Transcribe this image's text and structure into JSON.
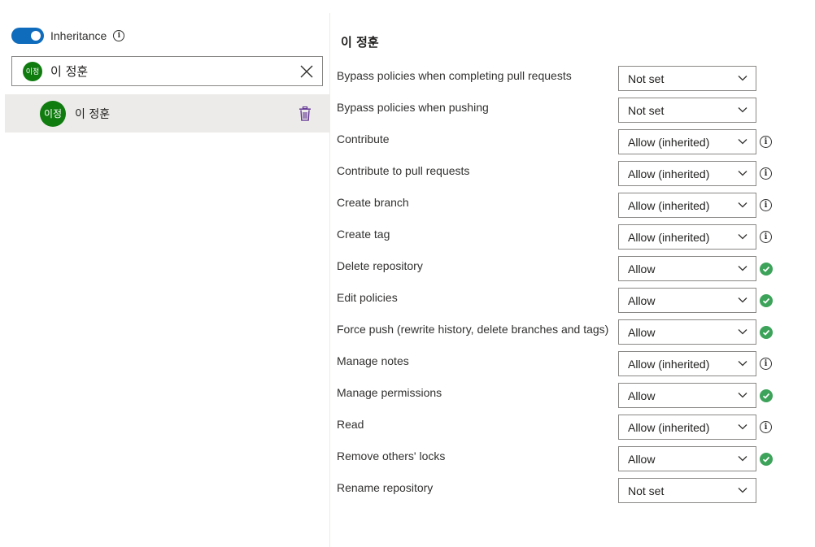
{
  "inheritance": {
    "label": "Inheritance",
    "enabled": true
  },
  "search": {
    "avatar_initials": "이정",
    "value": "이 정훈"
  },
  "selected_user": {
    "avatar_initials": "이정",
    "name": "이 정훈"
  },
  "detail": {
    "title": "이 정훈"
  },
  "colors": {
    "accent": "#0f6cbd",
    "avatar": "#107c10",
    "allow_check": "#3da35a",
    "selected_row": "#edebe9"
  },
  "permissions": [
    {
      "label": "Bypass policies when completing pull requests",
      "value": "Not set",
      "status": "none"
    },
    {
      "label": "Bypass policies when pushing",
      "value": "Not set",
      "status": "none"
    },
    {
      "label": "Contribute",
      "value": "Allow (inherited)",
      "status": "info-icon"
    },
    {
      "label": "Contribute to pull requests",
      "value": "Allow (inherited)",
      "status": "info-icon"
    },
    {
      "label": "Create branch",
      "value": "Allow (inherited)",
      "status": "info-icon"
    },
    {
      "label": "Create tag",
      "value": "Allow (inherited)",
      "status": "info-icon"
    },
    {
      "label": "Delete repository",
      "value": "Allow",
      "status": "check-icon"
    },
    {
      "label": "Edit policies",
      "value": "Allow",
      "status": "check-icon"
    },
    {
      "label": "Force push (rewrite history, delete branches and tags)",
      "value": "Allow",
      "status": "check-icon"
    },
    {
      "label": "Manage notes",
      "value": "Allow (inherited)",
      "status": "info-icon"
    },
    {
      "label": "Manage permissions",
      "value": "Allow",
      "status": "check-icon"
    },
    {
      "label": "Read",
      "value": "Allow (inherited)",
      "status": "info-icon"
    },
    {
      "label": "Remove others' locks",
      "value": "Allow",
      "status": "check-icon"
    },
    {
      "label": "Rename repository",
      "value": "Not set",
      "status": "none"
    }
  ]
}
